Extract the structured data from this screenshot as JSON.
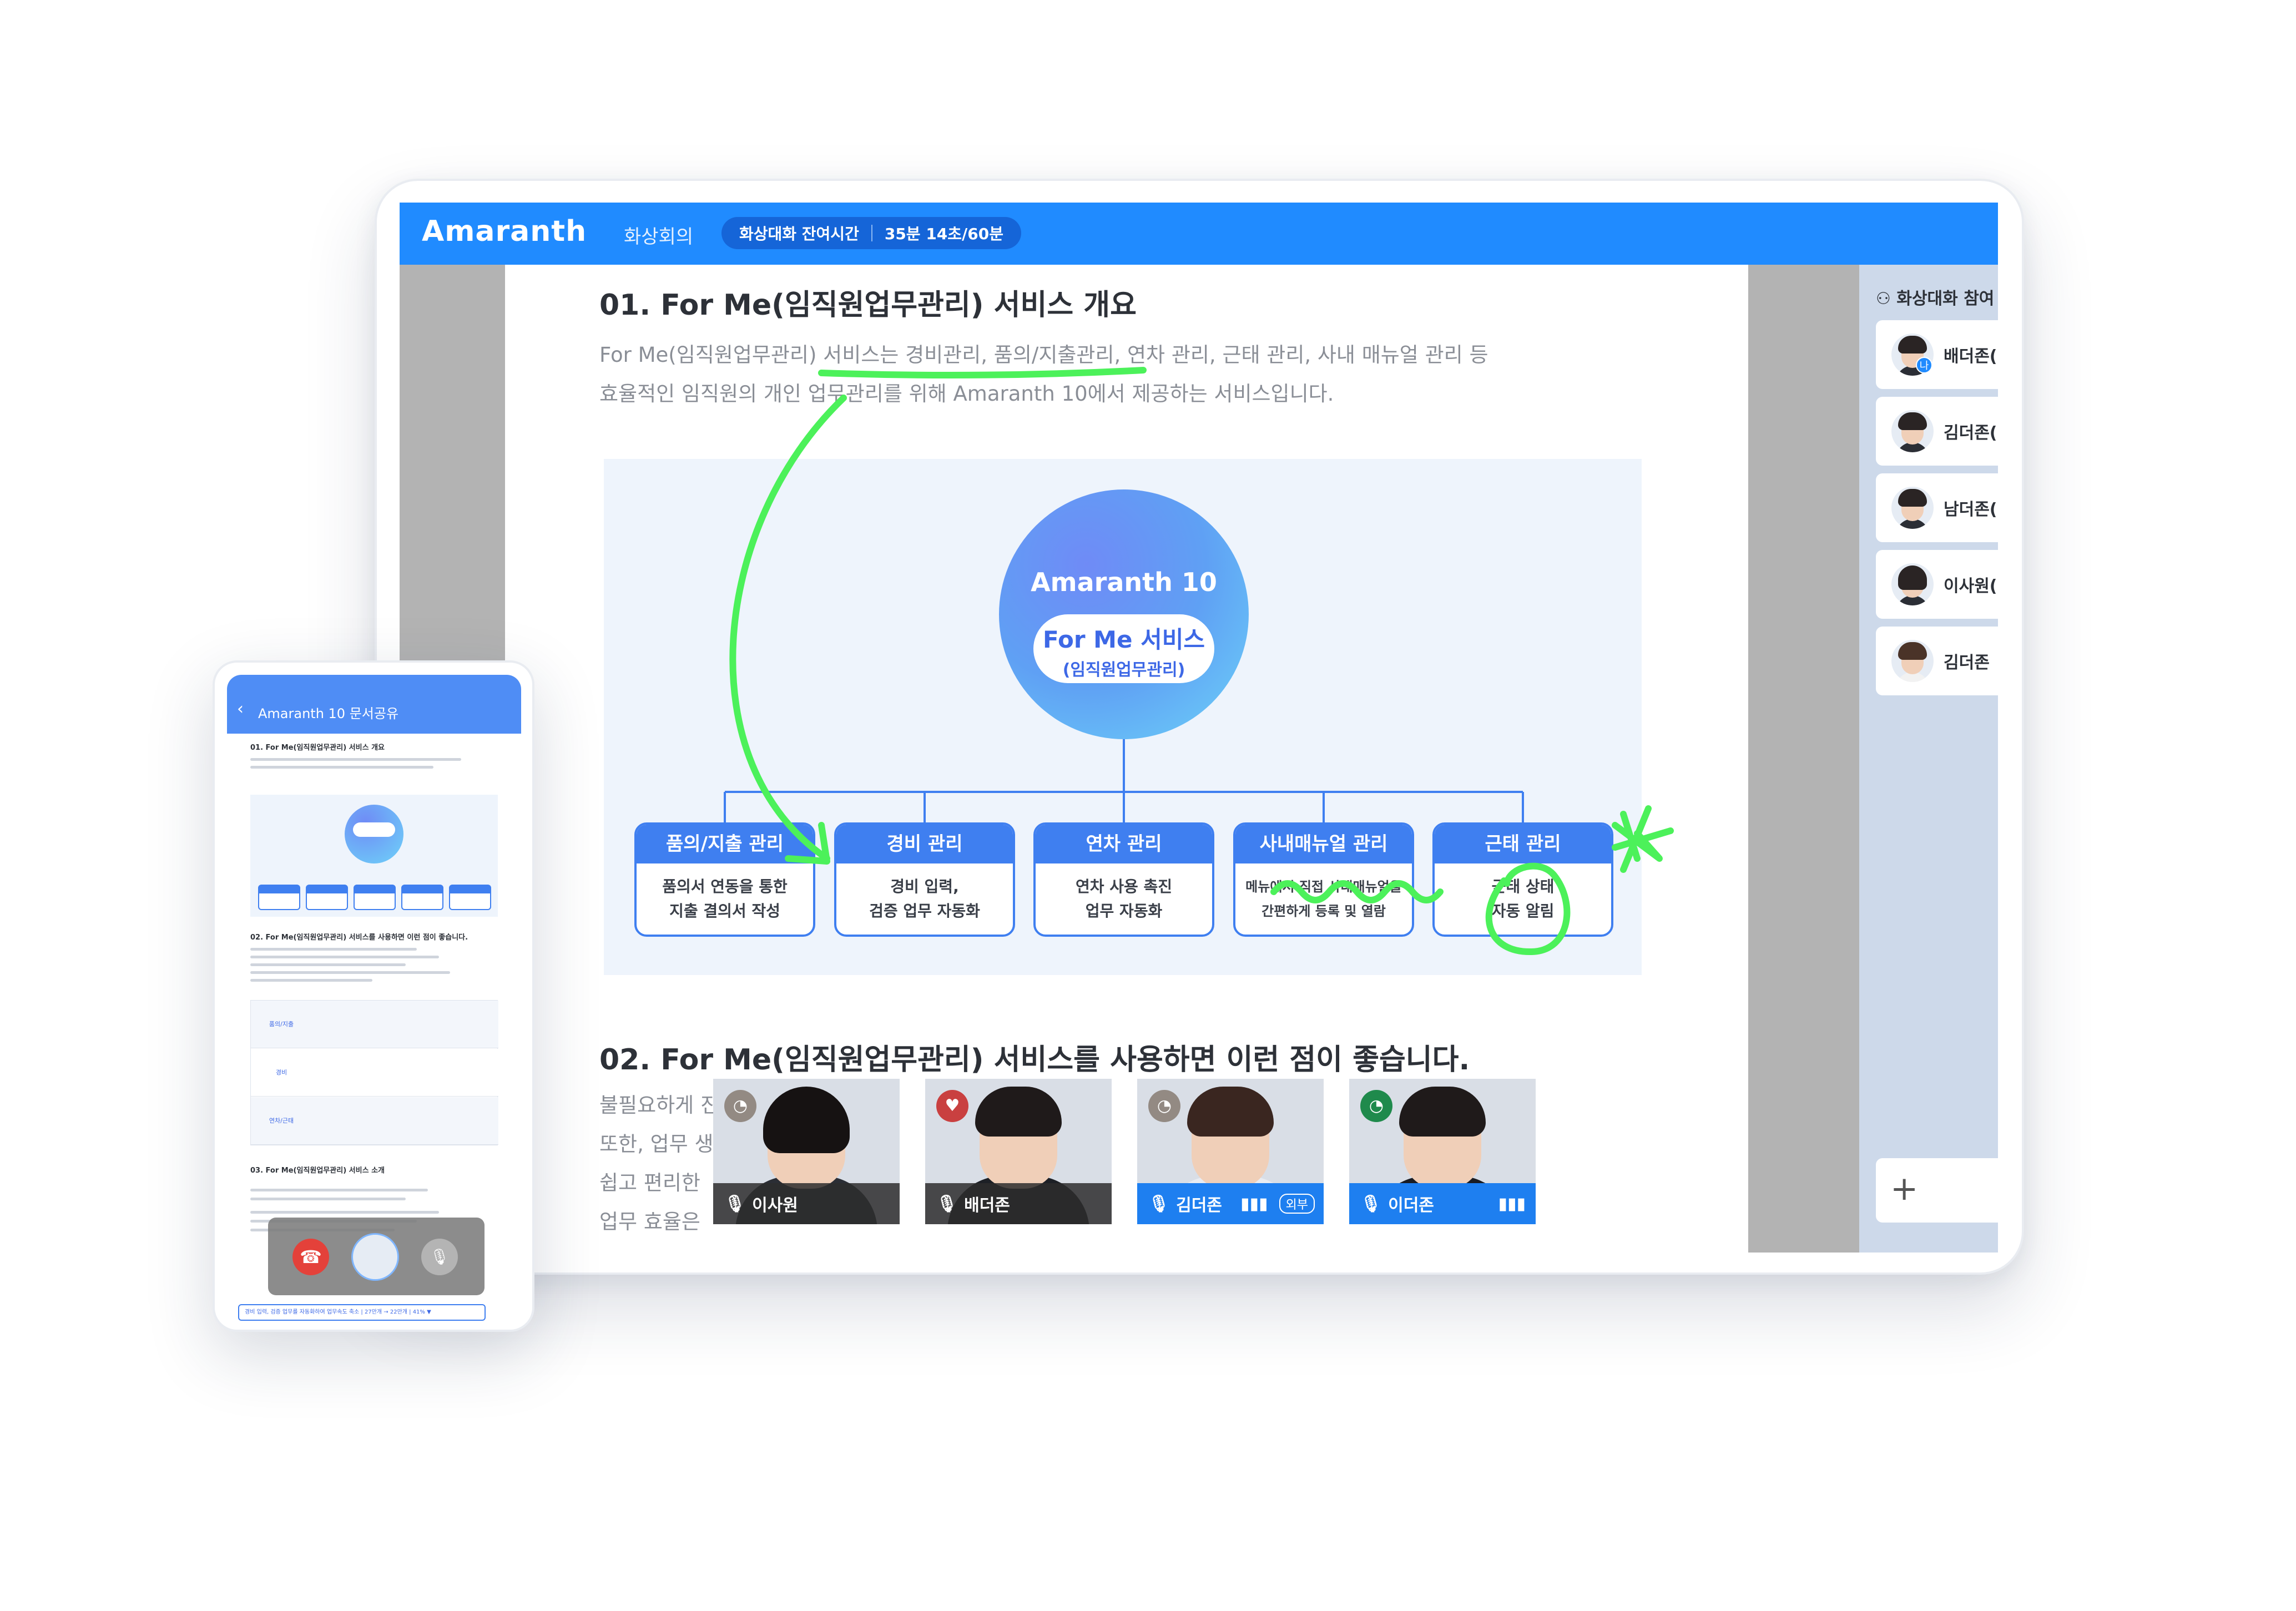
{
  "app": {
    "brand": "Amaranth",
    "menu_title": "화상회의",
    "timer_label": "화상대화 잔여시간",
    "timer_value": "35분 14초/60분"
  },
  "document": {
    "heading1": "01. For Me(임직원업무관리) 서비스 개요",
    "paragraph1_line1": "For Me(임직원업무관리) 서비스는 경비관리, 품의/지출관리, 연차 관리, 근태 관리, 사내 매뉴얼 관리 등",
    "paragraph1_line2": "효율적인 임직원의 개인 업무관리를 위해 Amaranth 10에서 제공하는 서비스입니다.",
    "heading2": "02. For Me(임직원업무관리) 서비스를 사용하면 이런 점이 좋습니다.",
    "paragraph2_lines": [
      "불필요하게 진",
      "또한, 업무 생",
      "쉽고 편리한",
      "업무 효율은"
    ]
  },
  "diagram": {
    "center_title": "Amaranth 10",
    "center_pill_main": "For Me 서비스",
    "center_pill_sub": "(임직원업무관리)",
    "boxes": [
      {
        "title": "품의/지출 관리",
        "line1": "품의서 연동을 통한",
        "line2": "지출 결의서 작성"
      },
      {
        "title": "경비 관리",
        "line1": "경비 입력,",
        "line2": "검증 업무 자동화"
      },
      {
        "title": "연차 관리",
        "line1": "연차 사용 촉진",
        "line2": "업무 자동화"
      },
      {
        "title": "사내매뉴얼 관리",
        "line1": "메뉴에서 직접 사내매뉴얼을",
        "line2": "간편하게 등록 및 열람"
      },
      {
        "title": "근태 관리",
        "line1": "근태 상태",
        "line2": "자동 알림"
      }
    ]
  },
  "video_tiles": [
    {
      "name": "이사원",
      "status": "wifi-icon",
      "active": false
    },
    {
      "name": "배더존",
      "status": "heart-icon",
      "active": false
    },
    {
      "name": "김더존",
      "status": "wifi-icon",
      "active": true,
      "badge": "외부"
    },
    {
      "name": "이더존",
      "status": "wifi-icon",
      "active": true
    }
  ],
  "participants": {
    "title": "화상대화 참여",
    "items": [
      "배더존(",
      "김더존(",
      "남더존(",
      "이사원(",
      "김더존"
    ],
    "me_badge": "나",
    "add_label": "+"
  },
  "phone": {
    "title": "Amaranth 10 문서공유",
    "doc_heading1": "01. For Me(임직원업무관리) 서비스 개요",
    "doc_heading2": "02. For Me(임직원업무관리) 서비스를 사용하면 이런 점이 좋습니다.",
    "doc_heading3": "03. For Me(임직원업무관리) 서비스 소개",
    "table_labels": [
      "품의/지출",
      "경비",
      "연차/근태"
    ],
    "footer_text": "경비 입력, 검증 업무를 자동화하여 업무속도 축소 | 27만개 → 22만개 | 41% ▼"
  },
  "colors": {
    "primary": "#208bff",
    "diagram_blue": "#3f7ff0",
    "ink_green": "#4cf15a",
    "end_call_red": "#e4413a"
  }
}
